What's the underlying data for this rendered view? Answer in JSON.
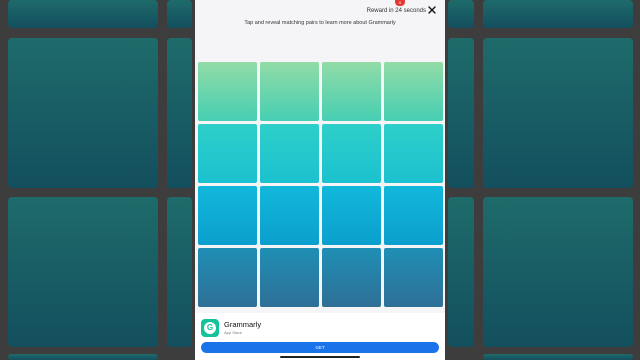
{
  "header": {
    "reward_text": "Reward in 24 seconds",
    "badge": "0"
  },
  "game": {
    "instructions": "Tap and reveal matching pairs to learn more about Grammarly",
    "cards": 16
  },
  "app": {
    "name": "Grammarly",
    "store": "App Store",
    "get_label": "GET"
  },
  "colors": {
    "accent": "#1a73e8",
    "logo": "#15c39a"
  }
}
